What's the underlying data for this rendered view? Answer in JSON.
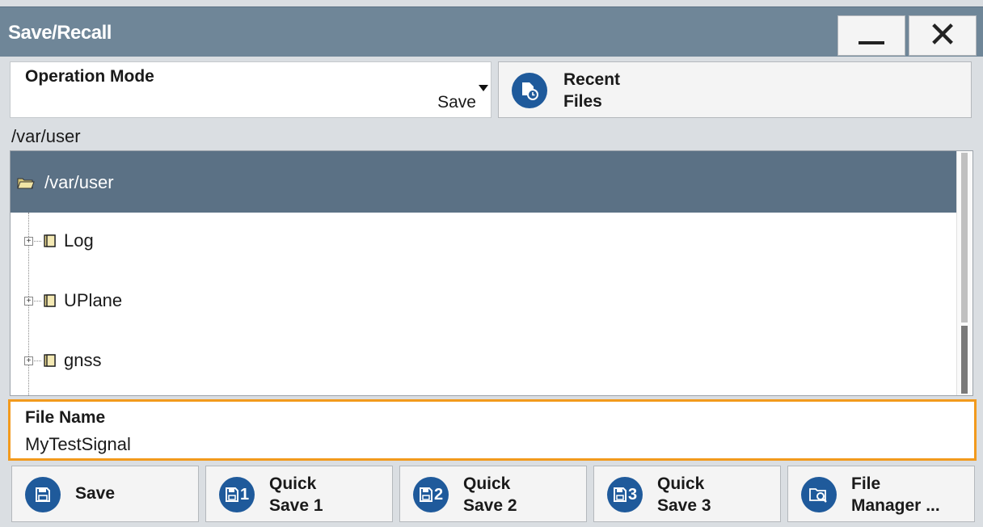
{
  "window": {
    "title": "Save/Recall",
    "minimize_icon": "minimize-icon",
    "close_icon": "close-icon"
  },
  "operation_mode": {
    "label": "Operation Mode",
    "value": "Save"
  },
  "recent_files": {
    "line1": "Recent",
    "line2": "Files",
    "icon": "recent-files-icon"
  },
  "current_path": "/var/user",
  "tree": {
    "root": "/var/user",
    "items": [
      {
        "label": "Log"
      },
      {
        "label": "UPlane"
      },
      {
        "label": "gnss"
      }
    ]
  },
  "file_name": {
    "label": "File Name",
    "value": "MyTestSignal"
  },
  "buttons": {
    "save": "Save",
    "quick1_line1": "Quick",
    "quick1_line2": "Save 1",
    "quick1_digit": "1",
    "quick2_line1": "Quick",
    "quick2_line2": "Save 2",
    "quick2_digit": "2",
    "quick3_line1": "Quick",
    "quick3_line2": "Save 3",
    "quick3_digit": "3",
    "fm_line1": "File",
    "fm_line2": "Manager ..."
  },
  "colors": {
    "titlebar": "#6f8698",
    "selected_row": "#5b7185",
    "accent_blue": "#1f5a9b",
    "focus_orange": "#f29a1d"
  }
}
